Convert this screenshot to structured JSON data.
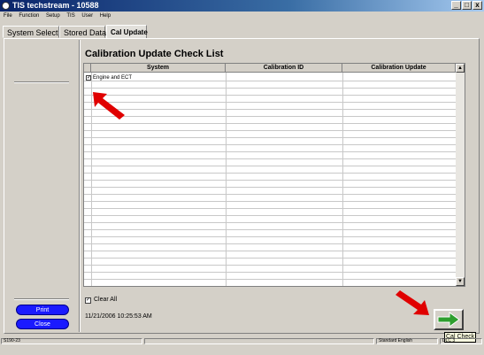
{
  "window": {
    "title": "TIS techstream - 10588",
    "minimize": "_",
    "maximize": "□",
    "close": "x"
  },
  "menu": [
    "File",
    "Function",
    "Setup",
    "TIS",
    "User",
    "Help"
  ],
  "tabs": [
    {
      "label": "System Select",
      "active": false
    },
    {
      "label": "Stored Data",
      "active": false
    },
    {
      "label": "Cal Update",
      "active": true
    }
  ],
  "page": {
    "title": "Calibration Update Check List"
  },
  "table": {
    "columns": [
      "System",
      "Calibration ID",
      "Calibration Update"
    ],
    "rows": [
      {
        "checked": true,
        "check_mark": "✓",
        "system": "Engine and ECT",
        "calibration_id": "",
        "calibration_update": ""
      }
    ]
  },
  "scrollbar": {
    "up": "▲",
    "down": "▼"
  },
  "clear_all": {
    "label": "Clear All",
    "check_mark": "✓"
  },
  "timestamp": "11/21/2006 10:25:53 AM",
  "buttons": {
    "print": "Print",
    "close": "Close"
  },
  "cal_check_tooltip": "Cal Check",
  "status_bar": {
    "left": "S190-23",
    "language": "Standard English",
    "right": "DLC 3"
  },
  "colors": {
    "button_blue": "#1a1aff",
    "arrow_red": "#e00000",
    "cal_check_green": "#2e9e2e"
  },
  "icons": {
    "app": "app-icon",
    "cal_check": "right-arrow-icon",
    "pointer": "red-pointer-arrow-icon"
  }
}
